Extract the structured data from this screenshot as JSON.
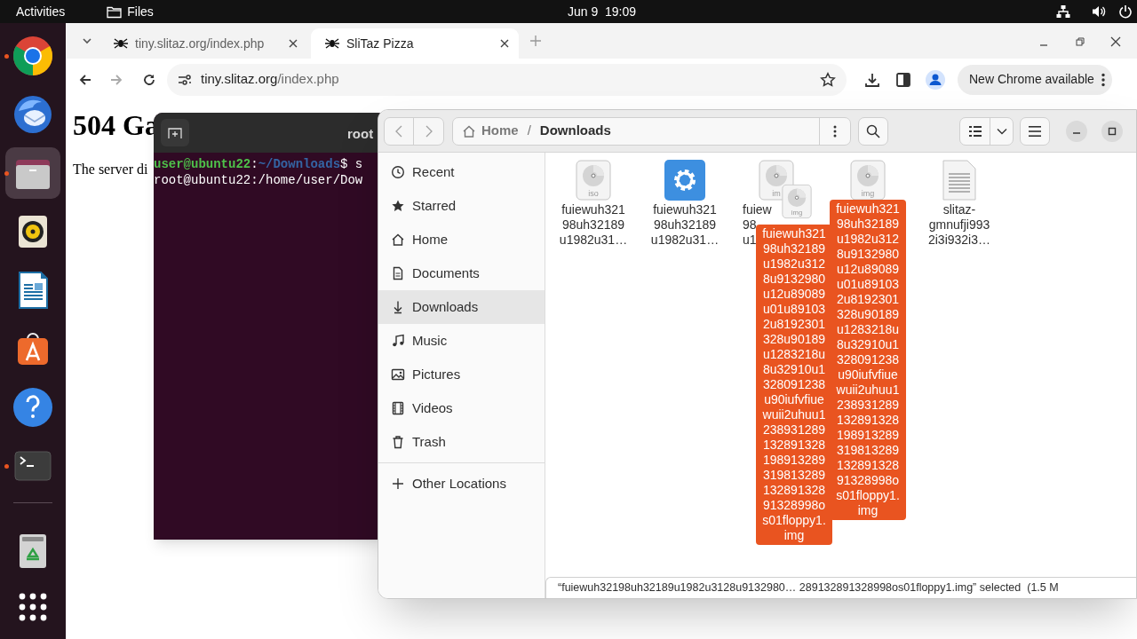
{
  "top_bar": {
    "activities": "Activities",
    "app_menu": "Files",
    "clock": "Jun 9  19:09"
  },
  "dock": {
    "items": [
      {
        "kind": "browser",
        "running": true,
        "selected": false
      },
      {
        "kind": "mail",
        "running": false,
        "selected": false
      },
      {
        "kind": "files",
        "running": true,
        "selected": true
      },
      {
        "kind": "music",
        "running": false,
        "selected": false
      },
      {
        "kind": "writer",
        "running": false,
        "selected": false
      },
      {
        "kind": "store",
        "running": false,
        "selected": false
      },
      {
        "kind": "help",
        "running": false,
        "selected": false
      },
      {
        "kind": "terminal",
        "running": true,
        "selected": false
      },
      {
        "kind": "trash",
        "running": false,
        "selected": false
      },
      {
        "kind": "apps",
        "running": false,
        "selected": false
      }
    ]
  },
  "browser": {
    "tabs": [
      {
        "title": "tiny.slitaz.org/index.php",
        "selected": false
      },
      {
        "title": "SliTaz Pizza",
        "selected": true
      }
    ],
    "url_host": "tiny.slitaz.org",
    "url_path": "/index.php",
    "update_button": "New Chrome available",
    "page": {
      "heading": "504 Ga",
      "text": "The server di"
    }
  },
  "terminal": {
    "title": "root",
    "lines": [
      {
        "kind": "prompt",
        "user": "user@ubuntu22",
        "sep": ":",
        "path": "~/Downloads",
        "rest": "$ s"
      },
      {
        "kind": "output",
        "text": "root@ubuntu22:/home/user/Dow"
      }
    ]
  },
  "files": {
    "path": [
      {
        "label": "Home",
        "current": false
      },
      {
        "label": "Downloads",
        "current": true
      }
    ],
    "path_separator": "/",
    "places": [
      {
        "kind": "recent",
        "label": "Recent",
        "selected": false
      },
      {
        "kind": "starred",
        "label": "Starred",
        "selected": false
      },
      {
        "kind": "home",
        "label": "Home",
        "selected": false
      },
      {
        "kind": "documents",
        "label": "Documents",
        "selected": false
      },
      {
        "kind": "downloads",
        "label": "Downloads",
        "selected": true
      },
      {
        "kind": "music",
        "label": "Music",
        "selected": false
      },
      {
        "kind": "pictures",
        "label": "Pictures",
        "selected": false
      },
      {
        "kind": "videos",
        "label": "Videos",
        "selected": false
      },
      {
        "kind": "trash",
        "label": "Trash",
        "selected": false
      }
    ],
    "other_locations": "Other Locations",
    "items": [
      {
        "kind": "disc",
        "badge": "iso",
        "name": "fuiewuh321\n98uh32189\nu1982u31…",
        "selected": false
      },
      {
        "kind": "gear",
        "name": "fuiewuh321\n98uh32189\nu1982u31…",
        "selected": false
      },
      {
        "kind": "disc",
        "badge": "im",
        "fragments": [
          "fuiew",
          "98",
          "u1"
        ],
        "selected": false
      },
      {
        "kind": "disc",
        "badge": "img",
        "name": "fuiewuh321\n98uh32189\nu1982u312\n8u9132980\nu12u89089\nu01u89103\n2u8192301\n328u90189\nu1283218u\n8u32910u1\n328091238\nu90iufvfiue\nwuii2uhuu1\n238931289\n132891328\n198913289\n319813289\n132891328\n91328998o\ns01floppy1.\nimg",
        "selected": true
      },
      {
        "kind": "text",
        "name": "slitaz-\ngmnufji993\n2i3i932i3…",
        "selected": false
      }
    ],
    "drag": {
      "badge": "img",
      "label": "fuiewuh321\n98uh32189\nu1982u312\n8u9132980\nu12u89089\nu01u89103\n2u8192301\n328u90189\nu1283218u\n8u32910u1\n328091238\nu90iufvfiue\nwuii2uhuu1\n238931289\n132891328\n198913289\n319813289\n132891328\n91328998o\ns01floppy1.\nimg"
    },
    "status": "“fuiewuh32198uh32189u1982u3128u9132980… 289132891328998os01floppy1.img” selected  (1.5 M"
  }
}
